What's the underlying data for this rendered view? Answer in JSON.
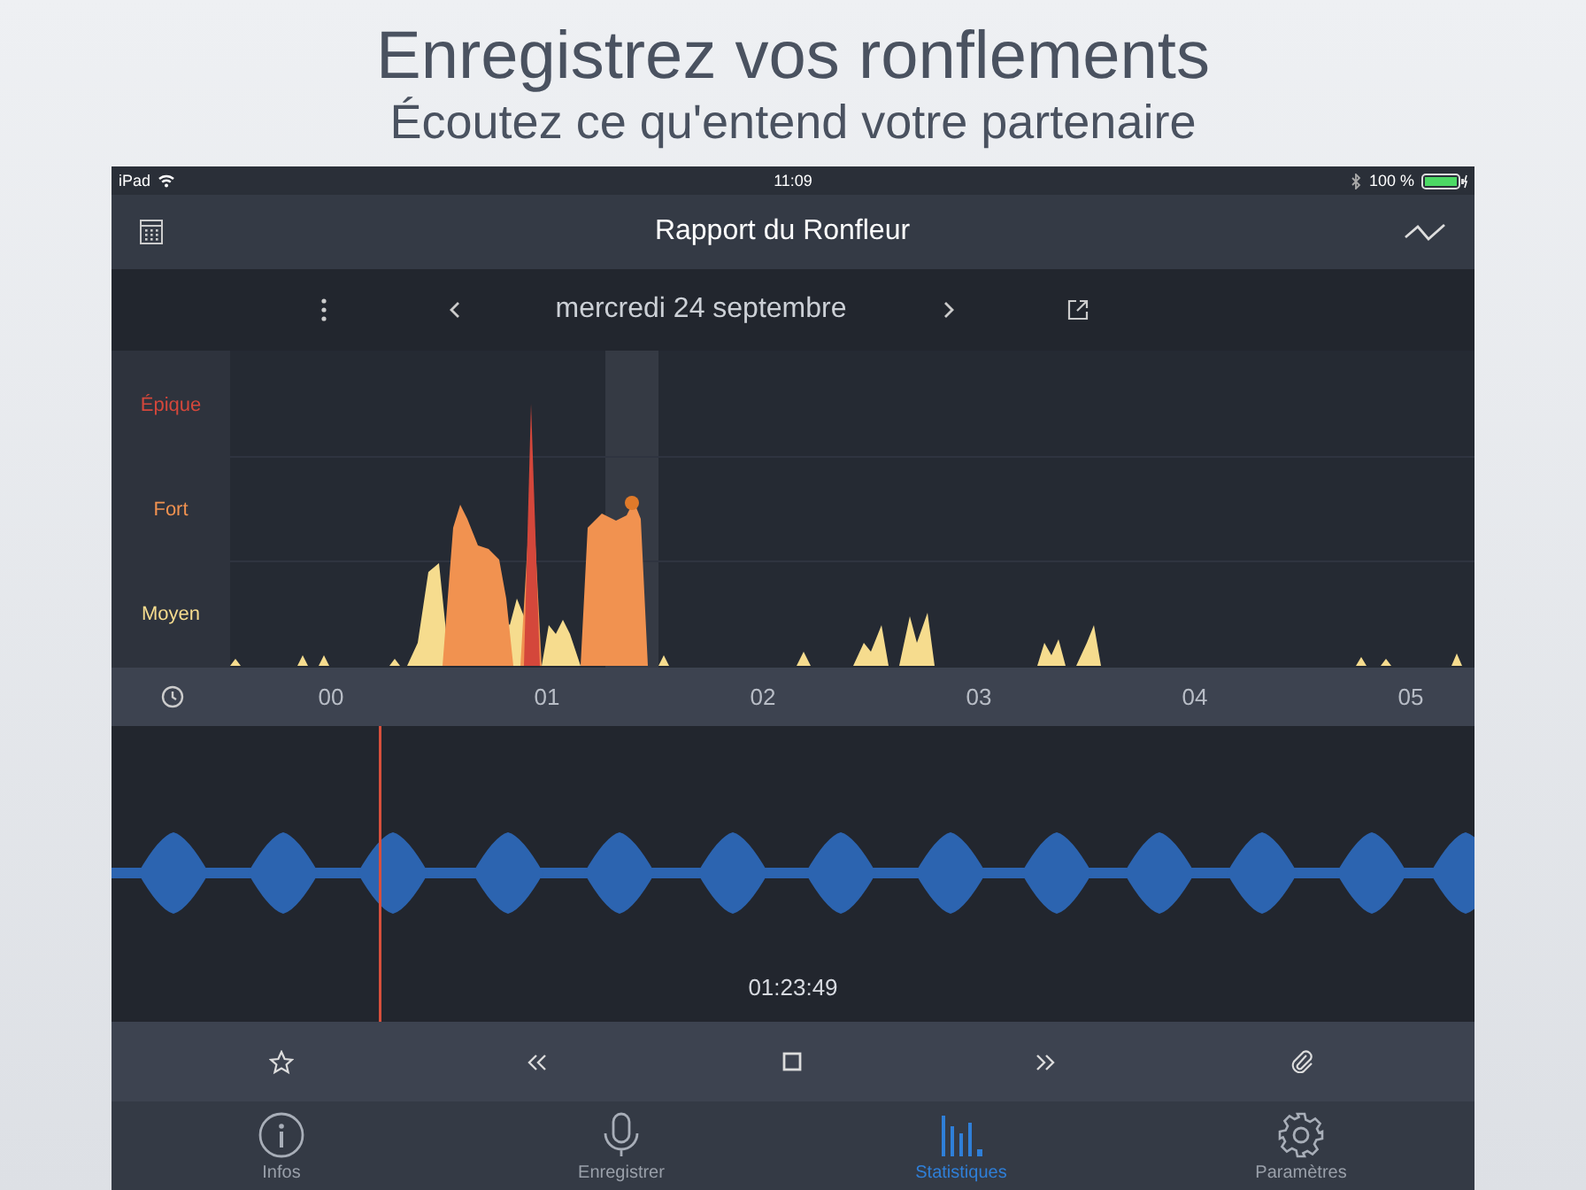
{
  "headline": {
    "title": "Enregistrez vos ronflements",
    "subtitle": "Écoutez ce qu'entend votre partenaire"
  },
  "status_bar": {
    "device": "iPad",
    "time": "11:09",
    "battery": "100 %"
  },
  "nav_bar": {
    "title": "Rapport du Ronfleur"
  },
  "date_bar": {
    "date": "mercredi 24 septembre"
  },
  "chart": {
    "levels": [
      {
        "label": "Épique",
        "color": "#d4473b"
      },
      {
        "label": "Fort",
        "color": "#f19250"
      },
      {
        "label": "Moyen",
        "color": "#f6dc8e"
      }
    ],
    "hours": [
      "00",
      "01",
      "02",
      "03",
      "04",
      "05"
    ]
  },
  "player": {
    "time": "01:23:49"
  },
  "tabs": [
    {
      "label": "Infos",
      "kind": "info",
      "selected": false
    },
    {
      "label": "Enregistrer",
      "kind": "record",
      "selected": false
    },
    {
      "label": "Statistiques",
      "kind": "stats",
      "selected": true
    },
    {
      "label": "Paramètres",
      "kind": "settings",
      "selected": false
    }
  ]
}
